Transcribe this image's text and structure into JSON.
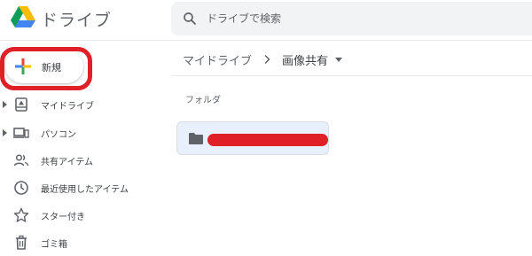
{
  "app": {
    "title": "ドライブ"
  },
  "search": {
    "placeholder": "ドライブで検索",
    "value": ""
  },
  "sidebar": {
    "new_button_label": "新規",
    "items": [
      {
        "label": "マイドライブ",
        "icon": "my-drive-icon",
        "expandable": true
      },
      {
        "label": "パソコン",
        "icon": "computers-icon",
        "expandable": true
      },
      {
        "label": "共有アイテム",
        "icon": "shared-people-icon",
        "expandable": false
      },
      {
        "label": "最近使用したアイテム",
        "icon": "clock-icon",
        "expandable": false
      },
      {
        "label": "スター付き",
        "icon": "star-icon",
        "expandable": false
      },
      {
        "label": "ゴミ箱",
        "icon": "trash-icon",
        "expandable": false
      }
    ]
  },
  "breadcrumb": {
    "root": "マイドライブ",
    "current": "画像共有"
  },
  "main": {
    "section_label": "フォルダ",
    "folders": [
      {
        "name": "",
        "redacted": true
      }
    ]
  },
  "colors": {
    "highlight": "#e02027",
    "folder_selected_bg": "#e8f0fe",
    "search_bg": "#f1f3f4",
    "text_secondary": "#5f6368"
  }
}
